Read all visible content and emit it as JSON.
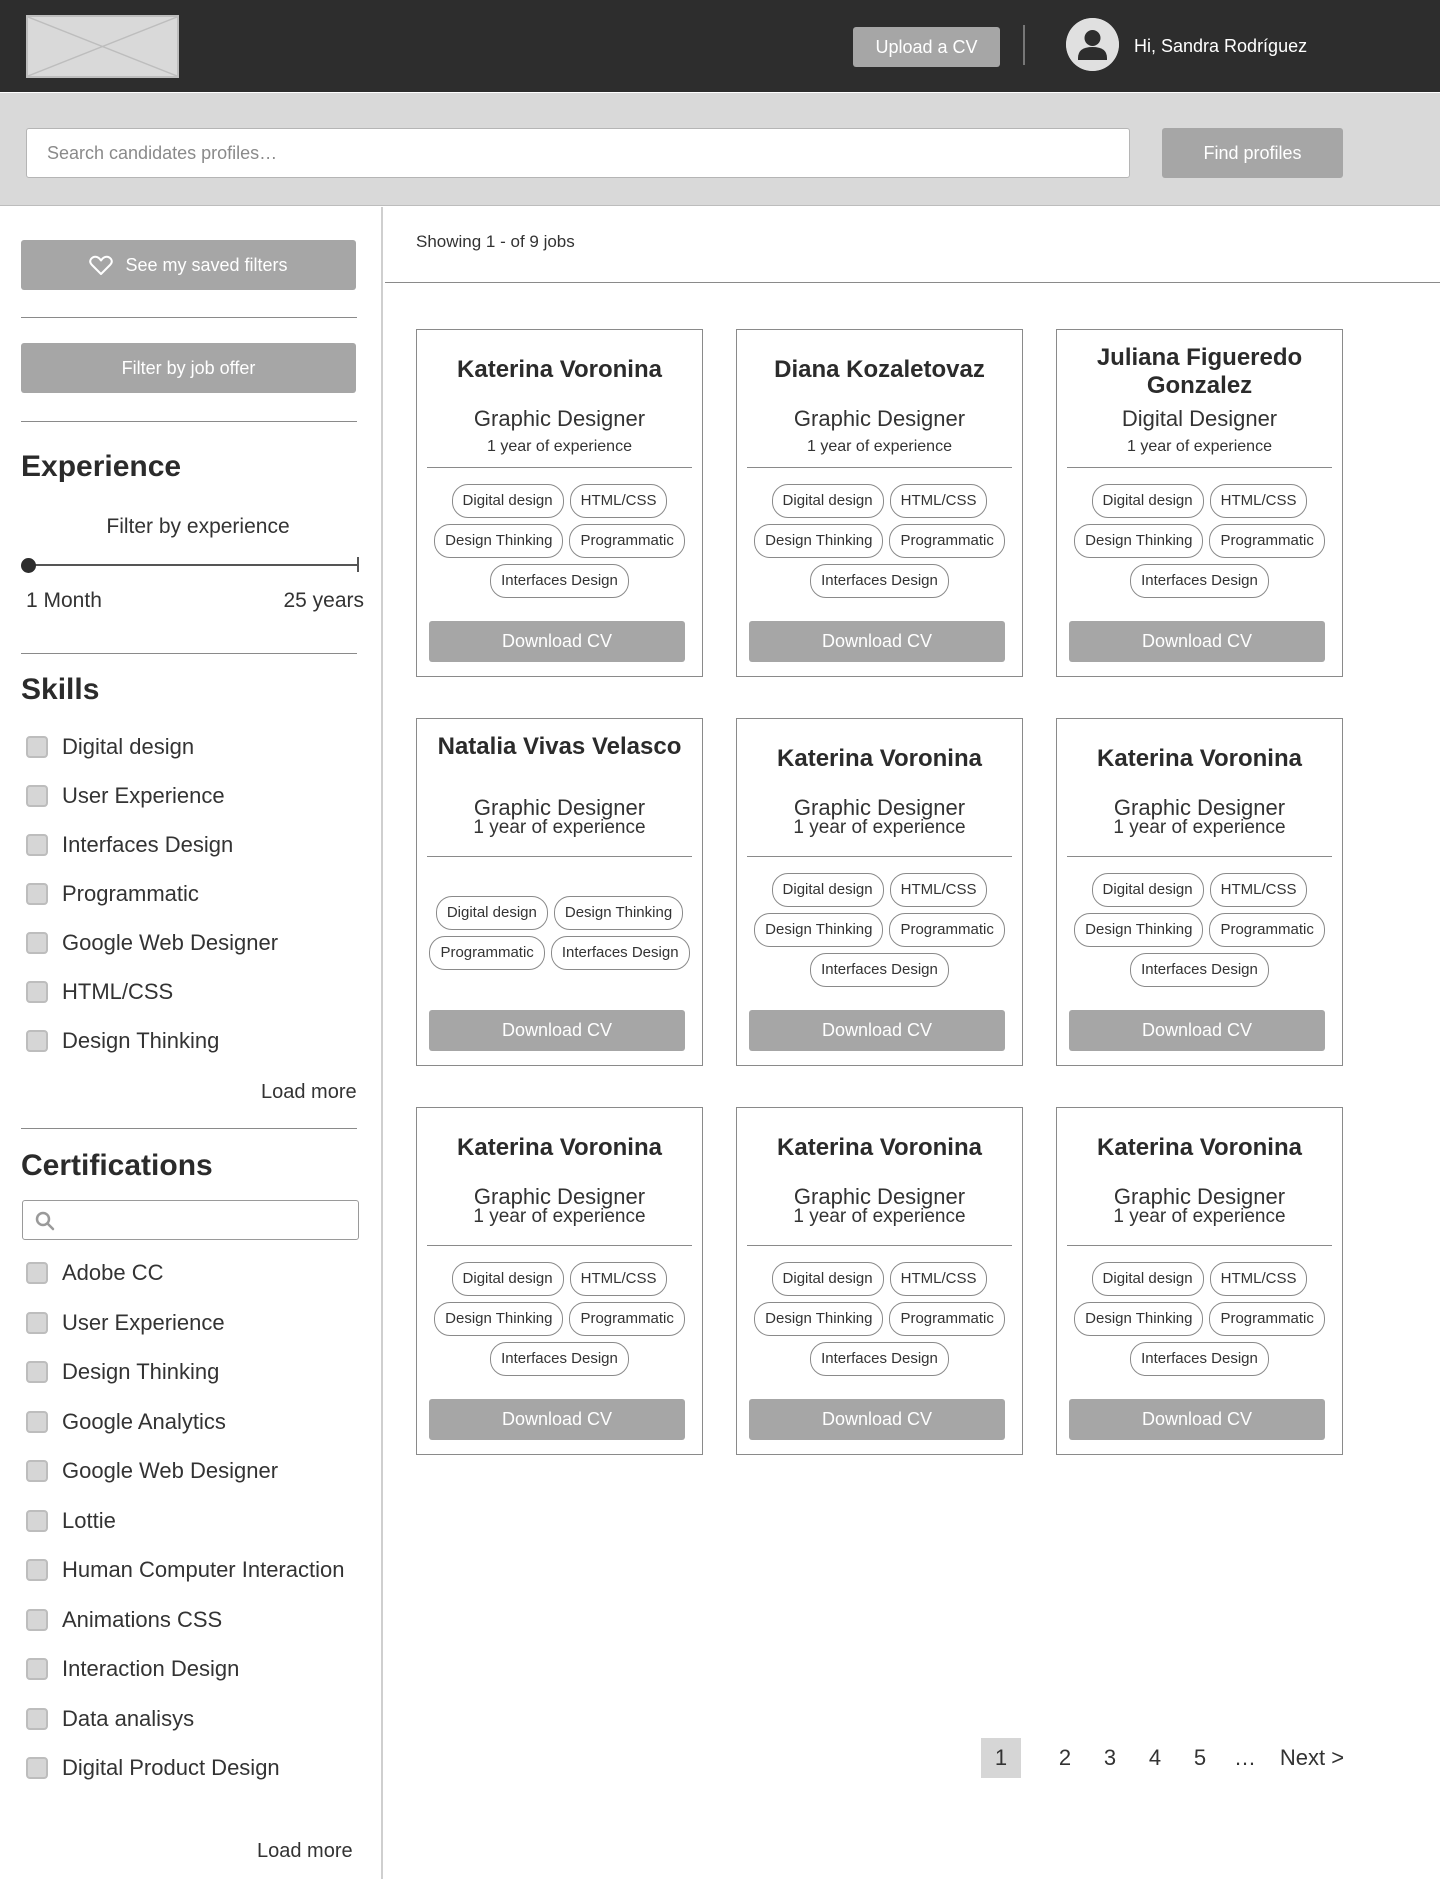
{
  "header": {
    "upload_label": "Upload a CV",
    "greeting": "Hi, Sandra Rodríguez"
  },
  "search": {
    "placeholder": "Search candidates profiles…",
    "find_label": "Find profiles"
  },
  "sidebar": {
    "saved_filters_label": "See my saved filters",
    "filter_job_label": "Filter by job offer",
    "experience": {
      "title": "Experience",
      "filter_label": "Filter by experience",
      "min_label": "1 Month",
      "max_label": "25 years",
      "selected_fraction": 0
    },
    "skills": {
      "title": "Skills",
      "items": [
        "Digital design",
        "User Experience",
        "Interfaces Design",
        "Programmatic",
        "Google Web Designer",
        "HTML/CSS",
        "Design Thinking"
      ],
      "load_more": "Load more"
    },
    "certifications": {
      "title": "Certifications",
      "items": [
        "Adobe CC",
        "User Experience",
        "Design Thinking",
        "Google Analytics",
        "Google Web Designer",
        "Lottie",
        "Human Computer Interaction",
        "Animations CSS",
        "Interaction Design",
        "Data analisys",
        "Digital Product Design"
      ],
      "load_more": "Load more"
    }
  },
  "results": {
    "showing": "Showing 1 - of 9 jobs",
    "download_label": "Download CV",
    "cards": [
      {
        "name": "Katerina Voronina",
        "role": "Graphic Designer",
        "experience": "1 year of experience",
        "tag_rows": [
          [
            "Digital design",
            "HTML/CSS"
          ],
          [
            "Design Thinking",
            "Programmatic"
          ],
          [
            "Interfaces Design"
          ]
        ]
      },
      {
        "name": "Diana Kozaletovaz",
        "role": "Graphic Designer",
        "experience": "1 year of experience",
        "tag_rows": [
          [
            "Digital design",
            "HTML/CSS"
          ],
          [
            "Design Thinking",
            "Programmatic"
          ],
          [
            "Interfaces Design"
          ]
        ]
      },
      {
        "name": "Juliana Figueredo Gonzalez",
        "role": "Digital Designer",
        "experience": "1 year of experience",
        "tag_rows": [
          [
            "Digital design",
            "HTML/CSS"
          ],
          [
            "Design Thinking",
            "Programmatic"
          ],
          [
            "Interfaces Design"
          ]
        ]
      },
      {
        "name": "Natalia Vivas Velasco",
        "role": "Graphic Designer",
        "experience": "1 year of experience",
        "tag_rows": [
          [
            "Digital design",
            "Design Thinking"
          ],
          [
            "Programmatic",
            "Interfaces Design"
          ]
        ]
      },
      {
        "name": "Katerina Voronina",
        "role": "Graphic Designer",
        "experience": "1 year of experience",
        "tag_rows": [
          [
            "Digital design",
            "HTML/CSS"
          ],
          [
            "Design Thinking",
            "Programmatic"
          ],
          [
            "Interfaces Design"
          ]
        ]
      },
      {
        "name": "Katerina Voronina",
        "role": "Graphic Designer",
        "experience": "1 year of experience",
        "tag_rows": [
          [
            "Digital design",
            "HTML/CSS"
          ],
          [
            "Design Thinking",
            "Programmatic"
          ],
          [
            "Interfaces Design"
          ]
        ]
      },
      {
        "name": "Katerina Voronina",
        "role": "Graphic Designer",
        "experience": "1 year of experience",
        "tag_rows": [
          [
            "Digital design",
            "HTML/CSS"
          ],
          [
            "Design Thinking",
            "Programmatic"
          ],
          [
            "Interfaces Design"
          ]
        ]
      },
      {
        "name": "Katerina Voronina",
        "role": "Graphic Designer",
        "experience": "1 year of experience",
        "tag_rows": [
          [
            "Digital design",
            "HTML/CSS"
          ],
          [
            "Design Thinking",
            "Programmatic"
          ],
          [
            "Interfaces Design"
          ]
        ]
      },
      {
        "name": "Katerina Voronina",
        "role": "Graphic Designer",
        "experience": "1 year of experience",
        "tag_rows": [
          [
            "Digital design",
            "HTML/CSS"
          ],
          [
            "Design Thinking",
            "Programmatic"
          ],
          [
            "Interfaces Design"
          ]
        ]
      }
    ]
  },
  "pagination": {
    "pages": [
      "1",
      "2",
      "3",
      "4",
      "5",
      "…"
    ],
    "current": "1",
    "next_label": "Next >"
  },
  "icons": {
    "logo": "image-placeholder-icon",
    "avatar": "user-avatar-icon",
    "saved_filters": "heart-icon",
    "cert_search": "search-icon"
  }
}
